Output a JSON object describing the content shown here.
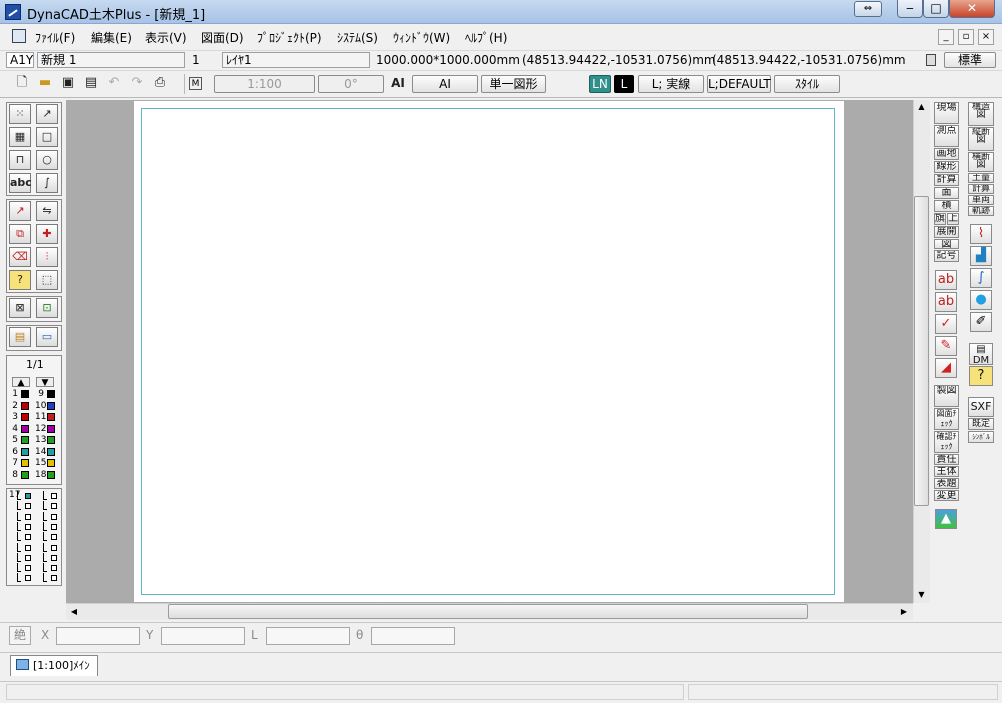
{
  "window": {
    "title": "DynaCAD土木Plus - [新規_1]",
    "caption_extra": "⇔",
    "minimize": "‒",
    "maximize": "□",
    "close": "✕"
  },
  "menu": {
    "items": [
      "ﾌｧｲﾙ(F)",
      "編集(E)",
      "表示(V)",
      "図面(D)",
      "ﾌﾟﾛｼﾞｪｸﾄ(P)",
      "ｼｽﾃﾑ(S)",
      "ｳｨﾝﾄﾞｳ(W)",
      "ﾍﾙﾌﾟ(H)"
    ],
    "mdi_min": "_",
    "mdi_restore": "▫",
    "mdi_close": "×"
  },
  "status": {
    "paper": "A1Y",
    "drawing_name": "新規 1",
    "layer_no": "1",
    "layer_name": "ﾚｲﾔ1",
    "size": "1000.000*1000.000mm",
    "coord1": "(48513.94422,-10531.0756)mm",
    "coord2": "(48513.94422,-10531.0756)mm",
    "mode": "標準"
  },
  "toolbar": {
    "m_label": "M",
    "scale": "1:100",
    "angle": "0°",
    "ai_icon": "AI",
    "ai": "AI",
    "single": "単一図形",
    "ln": "LN",
    "l": "L",
    "line_type": "L; 実線",
    "default": "L;DEFAULT",
    "style": "ｽﾀｲﾙ"
  },
  "left": {
    "page": "1/1",
    "abc": "abc",
    "group_no": "17",
    "colors": [
      {
        "n": "1",
        "c": "#000000"
      },
      {
        "n": "9",
        "c": "#000000"
      },
      {
        "n": "2",
        "c": "#c00000"
      },
      {
        "n": "10",
        "c": "#2040c0"
      },
      {
        "n": "3",
        "c": "#c00000"
      },
      {
        "n": "11",
        "c": "#c02020"
      },
      {
        "n": "4",
        "c": "#a000a0"
      },
      {
        "n": "12",
        "c": "#a000a0"
      },
      {
        "n": "5",
        "c": "#20a020"
      },
      {
        "n": "13",
        "c": "#20a020"
      },
      {
        "n": "6",
        "c": "#20a0a0"
      },
      {
        "n": "14",
        "c": "#20a0a0"
      },
      {
        "n": "7",
        "c": "#e0c000"
      },
      {
        "n": "15",
        "c": "#e0c000"
      },
      {
        "n": "8",
        "c": "#20a020"
      },
      {
        "n": "18",
        "c": "#20a020"
      }
    ]
  },
  "right1": {
    "genba": "現場",
    "sokuten": "測点",
    "menseki": "画地",
    "senkei": "線形",
    "keisan": "計算",
    "men": "面",
    "tsumi": "積",
    "hata": "旗",
    "agari": "上",
    "tenkai": "展開",
    "zu": "図",
    "kigou": "記号",
    "seizu": "製図",
    "zumen_check": "図面ﾁｪｯｸ",
    "kakunin_check": "確認ﾁｪｯｸ",
    "sekinin": "責任",
    "shutai": "主体",
    "hyoudai": "表題",
    "henkou": "変更"
  },
  "right2": {
    "kouzouzu": "構造図",
    "juudanzu": "縦断図",
    "oudanzu": "横断図",
    "doryou": "土量",
    "keisan": "計算",
    "sharyou": "車両",
    "kiseki": "軌跡",
    "dm": "DM",
    "help": "?",
    "sxf": "SXF",
    "kitei": "既定",
    "symbol": "ｼﾝﾎﾞﾙ"
  },
  "coordbar": {
    "abs": "絶",
    "x": "X",
    "y": "Y",
    "l": "L",
    "theta": "θ"
  },
  "tabs": {
    "main": "[1:100]ﾒｲﾝ"
  }
}
